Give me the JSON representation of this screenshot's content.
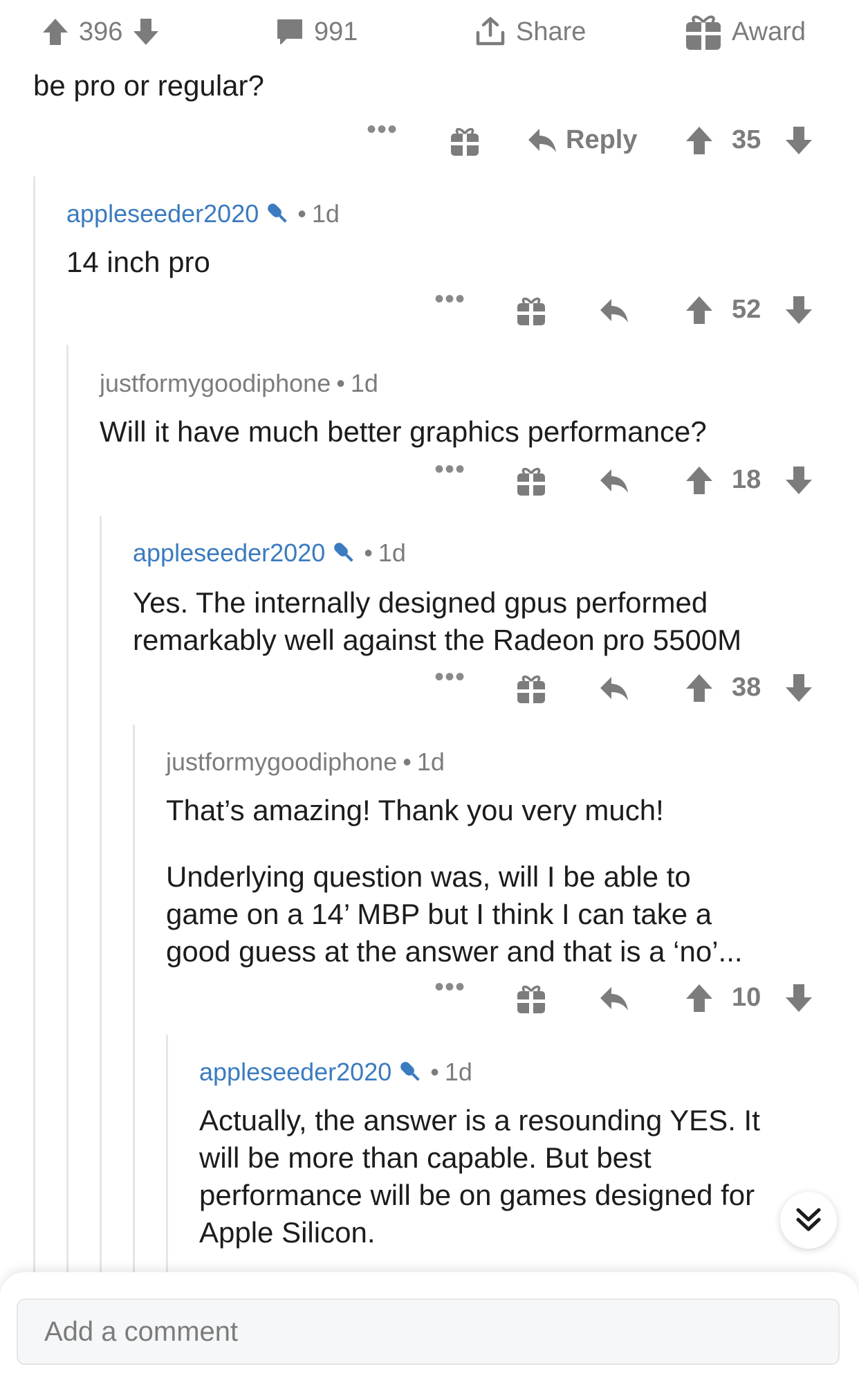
{
  "post_bar": {
    "upvotes": "396",
    "comments": "991",
    "share_label": "Share",
    "award_label": "Award"
  },
  "top_comment": {
    "text": "be pro or regular?",
    "reply_label": "Reply",
    "score": "35"
  },
  "comments": [
    {
      "author": "appleseeder2020",
      "is_op": true,
      "age": "1d",
      "text": "14 inch pro",
      "score": "52"
    },
    {
      "author": "justformygoodiphone",
      "is_op": false,
      "age": "1d",
      "text": "Will it have much better graphics performance?",
      "score": "18"
    },
    {
      "author": "appleseeder2020",
      "is_op": true,
      "age": "1d",
      "text_lines": [
        "Yes. The internally designed gpus performed",
        "remarkably well against the Radeon pro 5500M"
      ],
      "score": "38"
    },
    {
      "author": "justformygoodiphone",
      "is_op": false,
      "age": "1d",
      "text_para1": "That’s amazing! Thank you very much!",
      "text_lines": [
        "Underlying question was, will I be able to",
        "game on a 14’ MBP but I think I can take a",
        "good guess at the answer and that is a ‘no’..."
      ],
      "score": "10"
    },
    {
      "author": "appleseeder2020",
      "is_op": true,
      "age": "1d",
      "text_lines": [
        "Actually, the answer is a resounding YES. It",
        "will be more than capable. But best",
        "performance will be on games designed for",
        "Apple Silicon."
      ]
    }
  ],
  "separator": "•",
  "more_dots": "•••",
  "comment_input": {
    "placeholder": "Add a comment"
  },
  "colors": {
    "op_author": "#3b7bbf",
    "icon_gray": "#7c7c7c",
    "thread_line": "#e6e6e6"
  }
}
